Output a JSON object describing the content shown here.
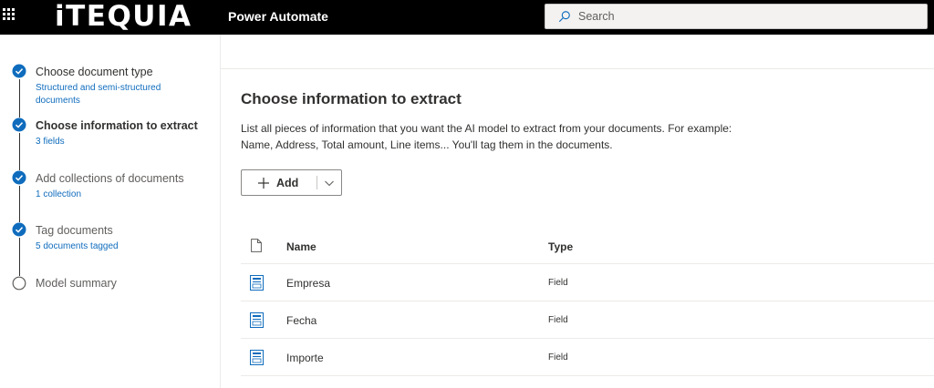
{
  "header": {
    "logo": "iTEQUIA",
    "app_title": "Power Automate",
    "search_placeholder": "Search"
  },
  "stepper": {
    "steps": [
      {
        "title": "Choose document type",
        "subtitle_lines": [
          "Structured and semi-structured",
          "documents"
        ],
        "status": "completed"
      },
      {
        "title": "Choose information to extract",
        "subtitle_lines": [
          "3 fields"
        ],
        "status": "current"
      },
      {
        "title": "Add collections of documents",
        "subtitle_lines": [
          "1 collection"
        ],
        "status": "completed"
      },
      {
        "title": "Tag documents",
        "subtitle_lines": [
          "5 documents tagged"
        ],
        "status": "completed"
      },
      {
        "title": "Model summary",
        "subtitle_lines": [],
        "status": "pending"
      }
    ]
  },
  "main": {
    "heading": "Choose information to extract",
    "description": "List all pieces of information that you want the AI model to extract from your documents. For example: Name, Address, Total amount, Line items... You'll tag them in the documents.",
    "add_button_label": "Add",
    "table": {
      "columns": [
        "Name",
        "Type"
      ],
      "rows": [
        {
          "name": "Empresa",
          "type": "Field"
        },
        {
          "name": "Fecha",
          "type": "Field"
        },
        {
          "name": "Importe",
          "type": "Field"
        }
      ]
    }
  },
  "colors": {
    "topbar": "#000000",
    "accent": "#0f6cbd",
    "check_fill": "#0f6cbd"
  },
  "icons": [
    "waffle-icon",
    "search-icon",
    "checkmark-circle-icon",
    "empty-circle-icon",
    "add-icon",
    "chevron-down-icon",
    "document-icon",
    "field-icon"
  ]
}
